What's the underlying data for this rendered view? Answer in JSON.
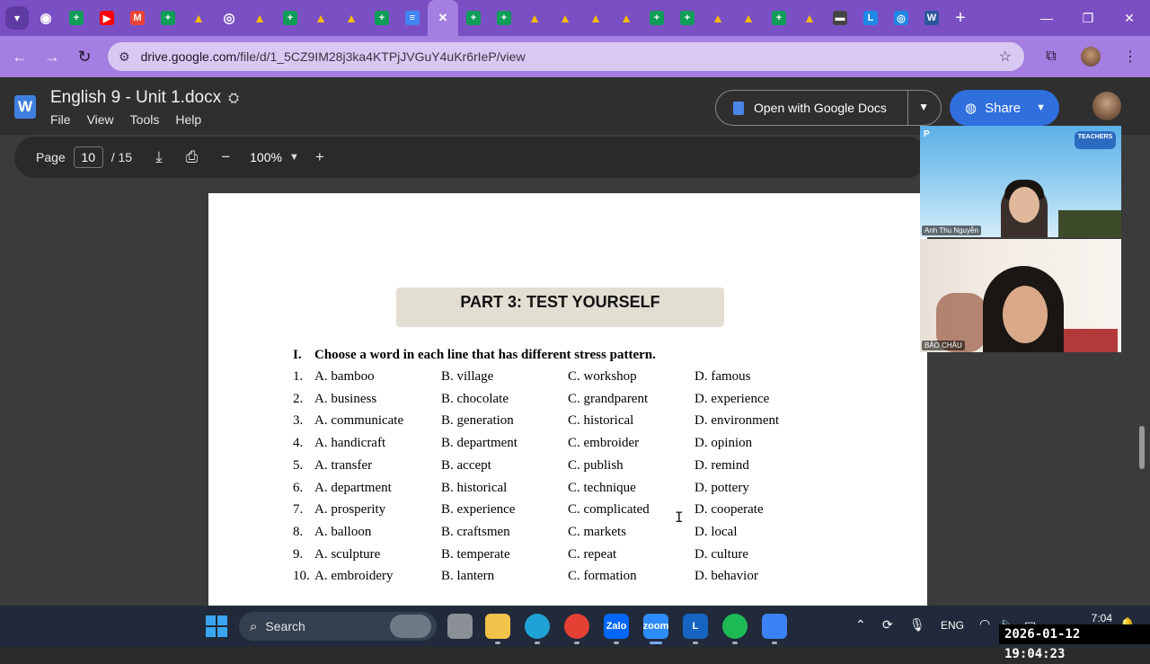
{
  "browser": {
    "url_host": "drive.google.com",
    "url_path": "/file/d/1_5CZ9IM28j3ka4KTPjJVGuY4uKr6rIeP/view",
    "tabs": [
      {
        "icon": "tab-list-icon"
      },
      {
        "icon": "chrome-icon"
      },
      {
        "icon": "sheets-icon",
        "color": "#0f9d58"
      },
      {
        "icon": "youtube-icon",
        "color": "#ff0000"
      },
      {
        "icon": "gmail-icon",
        "color": "#ea4335"
      },
      {
        "icon": "sheets-icon",
        "color": "#0f9d58"
      },
      {
        "icon": "drive-icon",
        "color": "#fbbc04"
      },
      {
        "icon": "globe-icon"
      },
      {
        "icon": "drive-icon",
        "color": "#fbbc04"
      },
      {
        "icon": "sheets-icon",
        "color": "#0f9d58"
      },
      {
        "icon": "drive-icon",
        "color": "#fbbc04"
      },
      {
        "icon": "drive-icon",
        "color": "#fbbc04"
      },
      {
        "icon": "sheets-icon",
        "color": "#0f9d58"
      },
      {
        "icon": "docs-icon",
        "color": "#4285f4"
      },
      {
        "icon": "close-icon",
        "active": true
      },
      {
        "icon": "sheets-icon",
        "color": "#0f9d58"
      },
      {
        "icon": "sheets-icon",
        "color": "#0f9d58"
      },
      {
        "icon": "drive-icon",
        "color": "#fbbc04"
      },
      {
        "icon": "drive-icon",
        "color": "#fbbc04"
      },
      {
        "icon": "drive-icon",
        "color": "#fbbc04"
      },
      {
        "icon": "drive-icon",
        "color": "#fbbc04"
      },
      {
        "icon": "sheets-icon",
        "color": "#0f9d58"
      },
      {
        "icon": "sheets-icon",
        "color": "#0f9d58"
      },
      {
        "icon": "drive-icon",
        "color": "#fbbc04"
      },
      {
        "icon": "drive-icon",
        "color": "#fbbc04"
      },
      {
        "icon": "sheets-icon",
        "color": "#0f9d58"
      },
      {
        "icon": "drive-icon",
        "color": "#fbbc04"
      },
      {
        "icon": "slides-icon"
      },
      {
        "icon": "l-icon",
        "color": "#1e88e5"
      },
      {
        "icon": "globe-icon",
        "color": "#1e88e5"
      },
      {
        "icon": "word-icon",
        "color": "#2b579a"
      }
    ]
  },
  "viewer": {
    "doc_title": "English 9 - Unit 1.docx",
    "menu": [
      "File",
      "View",
      "Tools",
      "Help"
    ],
    "open_with": "Open with Google Docs",
    "share": "Share",
    "page_label": "Page",
    "page_current": "10",
    "page_total": "/ 15",
    "zoom": "100%"
  },
  "document": {
    "part_title": "PART 3: TEST YOURSELF",
    "section_num": "I.",
    "section_text": "Choose a word in each line that has different stress pattern.",
    "questions": [
      {
        "n": "1.",
        "a": "A. bamboo",
        "b": "B. village",
        "c": "C. workshop",
        "d": "D. famous"
      },
      {
        "n": "2.",
        "a": "A. business",
        "b": "B. chocolate",
        "c": "C. grandparent",
        "d": "D. experience"
      },
      {
        "n": "3.",
        "a": "A. communicate",
        "b": "B. generation",
        "c": "C. historical",
        "d": "D. environment"
      },
      {
        "n": "4.",
        "a": "A. handicraft",
        "b": "B. department",
        "c": "C. embroider",
        "d": "D. opinion"
      },
      {
        "n": "5.",
        "a": "A. transfer",
        "b": "B. accept",
        "c": "C. publish",
        "d": "D. remind"
      },
      {
        "n": "6.",
        "a": "A. department",
        "b": "B. historical",
        "c": "C. technique",
        "d": "D. pottery"
      },
      {
        "n": "7.",
        "a": "A. prosperity",
        "b": "B. experience",
        "c": "C. complicated",
        "d": "D. cooperate"
      },
      {
        "n": "8.",
        "a": "A. balloon",
        "b": "B. craftsmen",
        "c": "C. markets",
        "d": "D. local"
      },
      {
        "n": "9.",
        "a": "A. sculpture",
        "b": "B. temperate",
        "c": "C. repeat",
        "d": "D. culture"
      },
      {
        "n": "10.",
        "a": "A. embroidery",
        "b": "B. lantern",
        "c": "C. formation",
        "d": "D. behavior"
      }
    ]
  },
  "video": {
    "tile1_name": "Anh Thu Nguyễn",
    "tile2_name": "BẢO CHÂU",
    "tile1_brand": "P",
    "tile1_logo": "TEACHERS"
  },
  "taskbar": {
    "search": "Search",
    "lang": "ENG",
    "time": "7:04 CH",
    "timestamp": "2026-01-12 19:04:23",
    "apps": [
      {
        "name": "taskview-icon",
        "color": "#8a8f98",
        "label": ""
      },
      {
        "name": "file-explorer-icon",
        "color": "#f2c34a",
        "label": ""
      },
      {
        "name": "edge-icon",
        "color": "#1fa3d6",
        "label": ""
      },
      {
        "name": "chrome-icon",
        "color": "#e44134",
        "label": ""
      },
      {
        "name": "zalo-icon",
        "color": "#0068ff",
        "label": "Zalo"
      },
      {
        "name": "zoom-icon",
        "color": "#2d8cff",
        "label": "zoom"
      },
      {
        "name": "l-app-icon",
        "color": "#1565c0",
        "label": "L"
      },
      {
        "name": "spotify-icon",
        "color": "#1db954",
        "label": ""
      },
      {
        "name": "store-icon",
        "color": "#3b82f6",
        "label": ""
      }
    ]
  }
}
